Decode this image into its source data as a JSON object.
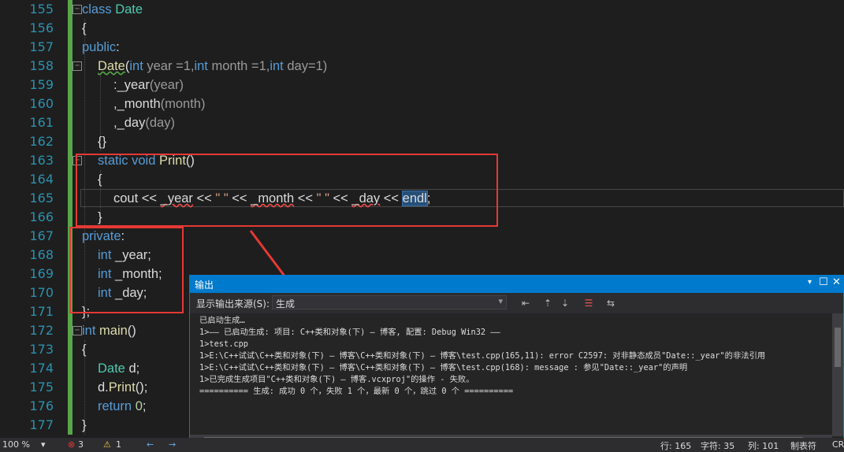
{
  "code": {
    "line_numbers": [
      "155",
      "156",
      "157",
      "158",
      "159",
      "160",
      "161",
      "162",
      "163",
      "164",
      "165",
      "166",
      "167",
      "168",
      "169",
      "170",
      "171",
      "172",
      "173",
      "174",
      "175",
      "176",
      "177"
    ],
    "l155_kw": "class",
    "l155_name": "Date",
    "brace_open": "{",
    "brace_close": "}",
    "access_public": "public",
    "colon": ":",
    "l158_ctor": "Date",
    "l158_p1t": "int",
    "l158_p1": " year =1,",
    "l158_p2t": "int",
    "l158_p2": " month =1,",
    "l158_p3t": "int",
    "l158_p3": " day=1)",
    "l158_open": "(",
    "l159_a": ":_year",
    "l159_b": "(year)",
    "l160_a": ",_month",
    "l160_b": "(month)",
    "l161_a": ",_day",
    "l161_b": "(day)",
    "l162": "{}",
    "l163_static": "static",
    "l163_void": "void",
    "l163_fn": "Print",
    "l163_parens": "()",
    "l165_cout": "cout",
    "l165_op": " << ",
    "l165_year": "_year",
    "l165_space_str": "\" \"",
    "l165_month": "_month",
    "l165_day": "_day",
    "l165_endl": "endl",
    "l165_semi": ";",
    "access_private": "private",
    "l168_t": "int",
    "l168_v": " _year;",
    "l169_t": "int",
    "l169_v": " _month;",
    "l170_t": "int",
    "l170_v": " _day;",
    "l171": "};",
    "l172_t": "int",
    "l172_fn": "main",
    "l172_p": "()",
    "l174_t": "Date",
    "l174_v": " d;",
    "l175_v": "d.",
    "l175_fn": "Print",
    "l175_p": "();",
    "l176_kw": "return",
    "l176_num": "0",
    "l176_semi": ";"
  },
  "output_panel": {
    "title": "输出",
    "source_label": "显示输出来源(S):",
    "source_value": "生成",
    "lines": [
      "已启动生成…",
      "1>—— 已启动生成: 项目: C++类和对象(下) — 博客, 配置: Debug Win32 ——",
      "1>test.cpp",
      "1>E:\\C++试试\\C++类和对象(下) — 博客\\C++类和对象(下) — 博客\\test.cpp(165,11): error C2597: 对非静态成员\"Date::_year\"的非法引用",
      "1>E:\\C++试试\\C++类和对象(下) — 博客\\C++类和对象(下) — 博客\\test.cpp(168): message : 参见\"Date::_year\"的声明",
      "1>已完成生成项目\"C++类和对象(下) — 博客.vcxproj\"的操作 - 失败。",
      "========== 生成: 成功 0 个，失败 1 个，最新 0 个，跳过 0 个 =========="
    ]
  },
  "status_bar": {
    "zoom": "100 %",
    "errors": "3",
    "warnings": "1",
    "line": "行: 165",
    "char": "字符: 35",
    "col": "列: 101",
    "mode": "制表符",
    "eol": "CR"
  },
  "colors": {
    "accent": "#007acc",
    "annotation": "#e53935"
  }
}
